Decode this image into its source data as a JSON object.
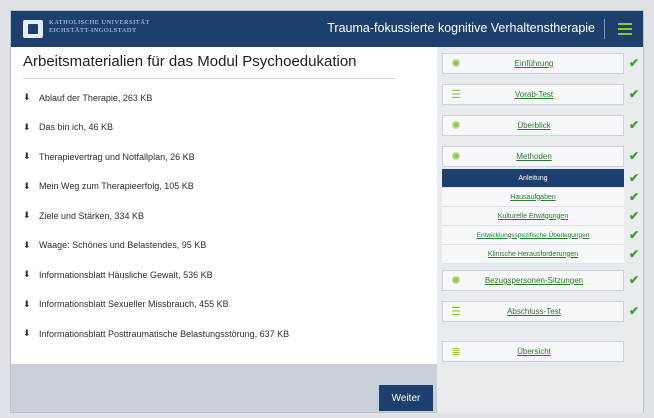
{
  "header": {
    "logo_text": "KATHOLISCHE UNIVERSITÄT EICHSTÄTT-INGOLSTADT",
    "title": "Trauma-fokussierte kognitive Verhaltenstherapie"
  },
  "main": {
    "title": "Arbeitsmaterialien für das Modul Psychoedukation",
    "download_icon": "download-icon",
    "downloads": [
      "Ablauf der Therapie, 263 KB",
      "Das bin ich, 46 KB",
      "Therapievertrag und Notfallplan, 26 KB",
      "Mein Weg zum Therapieerfolg, 105 KB",
      "Ziele und Stärken, 334 KB",
      "Waage: Schönes und Belastendes, 95 KB",
      "Informationsblatt Häusliche Gewalt, 536 KB",
      "Informationsblatt Sexueller Missbrauch, 455 KB",
      "Informationsblatt Posttraumatische Belastungsstörung, 637 KB"
    ],
    "next_label": "Weiter"
  },
  "sidebar": {
    "items": [
      {
        "label": "Einführung",
        "icon": "lightbulb-icon",
        "done": true
      },
      {
        "label": "Vorab-Test",
        "icon": "checklist-icon",
        "done": true
      },
      {
        "label": "Überblick",
        "icon": "lightbulb-icon",
        "done": true
      },
      {
        "label": "Methoden",
        "icon": "lightbulb-icon",
        "done": true
      },
      {
        "label": "Bezugspersonen-Sitzungen",
        "icon": "chat-icon",
        "done": true
      },
      {
        "label": "Abschluss-Test",
        "icon": "checklist-icon",
        "done": true
      },
      {
        "label": "Übersicht",
        "icon": "list-icon",
        "done": false
      }
    ],
    "sub_items": [
      {
        "label": "Anleitung",
        "active": true,
        "done": true
      },
      {
        "label": "Hausaufgaben",
        "active": false,
        "done": true
      },
      {
        "label": "Kulturelle Erwägungen",
        "active": false,
        "done": true
      },
      {
        "label": "Entwicklungsspezifische Überlegungen",
        "active": false,
        "done": true
      },
      {
        "label": "Klinische Herausforderungen",
        "active": false,
        "done": true
      }
    ]
  },
  "colors": {
    "navy": "#1d3f6e",
    "green": "#8cc63f",
    "check": "#3f9b2f"
  }
}
